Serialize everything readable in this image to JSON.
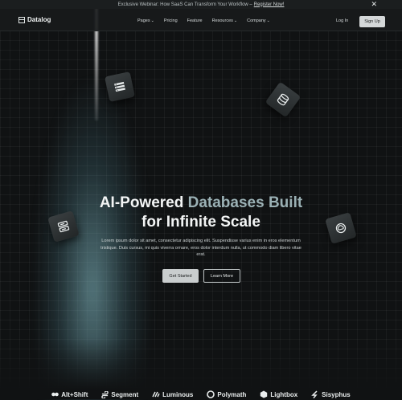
{
  "banner": {
    "text": "Exclusive Webinar: How SaaS Can Transform Your Workflow –",
    "link": "Register Now!",
    "close_icon": "close-icon"
  },
  "nav": {
    "logo": "Datalog",
    "items": [
      {
        "label": "Pages",
        "dropdown": true
      },
      {
        "label": "Pricing",
        "dropdown": false
      },
      {
        "label": "Feature",
        "dropdown": false
      },
      {
        "label": "Resources",
        "dropdown": true
      },
      {
        "label": "Company",
        "dropdown": true
      }
    ],
    "chevron": "⌄",
    "login": "Log In",
    "signup": "Sign Up"
  },
  "hero": {
    "title_plain": "AI-Powered",
    "title_accent": "Databases Built",
    "title_line2": "for Infinite Scale",
    "subtitle": "Lorem ipsum dolor sit amet, consectetur adipiscing elit. Suspendisse varius enim in eros elementum tristique. Duis cursus, mi quis viverra ornare, eros dolor interdum nulla, ut commodo diam libero vitae erat.",
    "primary_button": "Get Started",
    "secondary_button": "Learn More"
  },
  "floating_icons": [
    "server-list-icon",
    "database-icon",
    "server-rack-icon",
    "cloud-sync-icon"
  ],
  "logos": [
    "Alt+Shift",
    "Segment",
    "Luminous",
    "Polymath",
    "Lightbox",
    "Sisyphus"
  ],
  "colors": {
    "background": "#101213",
    "accent_text": "#9bb1b5",
    "beam": "#8cc8d2"
  }
}
